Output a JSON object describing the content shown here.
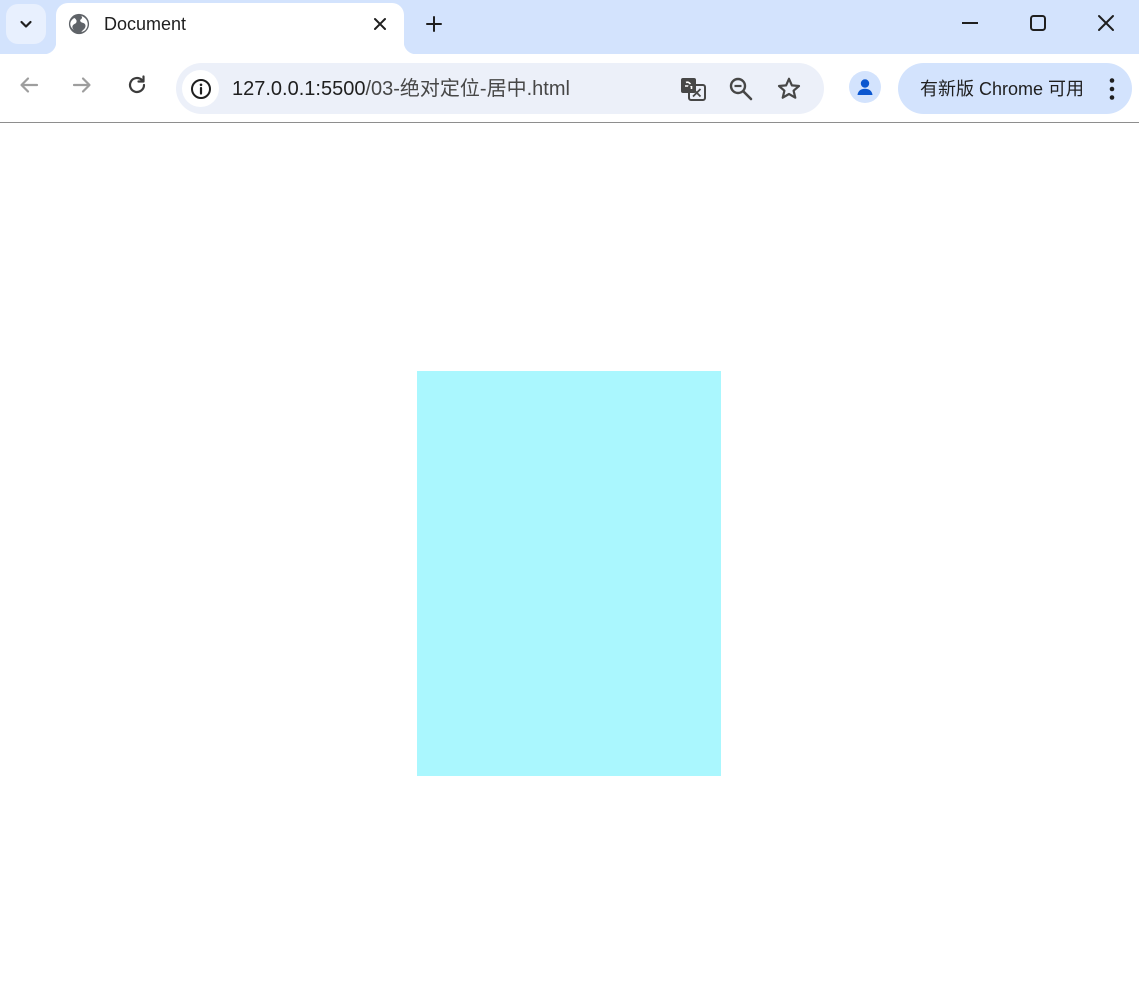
{
  "tab": {
    "title": "Document",
    "favicon": "globe-icon"
  },
  "window_controls": {
    "minimize": "minimize-icon",
    "maximize": "maximize-icon",
    "close": "close-icon"
  },
  "toolbar": {
    "back": "arrow-left-icon",
    "forward": "arrow-right-icon",
    "reload": "reload-icon"
  },
  "omnibox": {
    "url_host": "127.0.0.1:5500",
    "url_path": "/03-绝对定位-居中.html",
    "site_info": "info-icon",
    "actions": [
      "translate-icon",
      "zoom-out-icon",
      "star-icon"
    ]
  },
  "update_chip": {
    "label": "有新版 Chrome 可用"
  },
  "colors": {
    "tabstrip": "#d3e3fd",
    "omnibox": "#ecf0f9",
    "box": "#aaf7fe"
  }
}
